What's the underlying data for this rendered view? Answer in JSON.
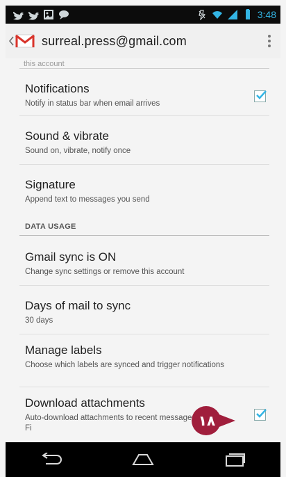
{
  "status_bar": {
    "time": "3:48",
    "icons": [
      "twitter-icon",
      "twitter-icon",
      "image-icon",
      "chat-icon",
      "mute-icon",
      "wifi-icon",
      "signal-icon",
      "battery-icon"
    ]
  },
  "action_bar": {
    "title": "surreal.press@gmail.com"
  },
  "content": {
    "cut_off_text": "this account",
    "items": [
      {
        "title": "Notifications",
        "summary": "Notify in status bar when email arrives",
        "checked": true
      },
      {
        "title": "Sound & vibrate",
        "summary": "Sound on, vibrate, notify once"
      },
      {
        "title": "Signature",
        "summary": "Append text to messages you send"
      }
    ],
    "section_header": "DATA USAGE",
    "data_items": [
      {
        "title": "Gmail sync is ON",
        "summary": "Change sync settings or remove this account"
      },
      {
        "title": "Days of mail to sync",
        "summary": "30 days"
      },
      {
        "title": "Manage labels",
        "summary": "Choose which labels are synced and trigger notifications"
      },
      {
        "title": "Download attachments",
        "summary": "Auto-download attachments to recent messages via Wi-Fi",
        "checked": true
      }
    ]
  },
  "callout": {
    "number": "١٨",
    "color": "#a01e3c"
  },
  "colors": {
    "accent": "#33b5e5",
    "callout": "#a01e3c"
  }
}
